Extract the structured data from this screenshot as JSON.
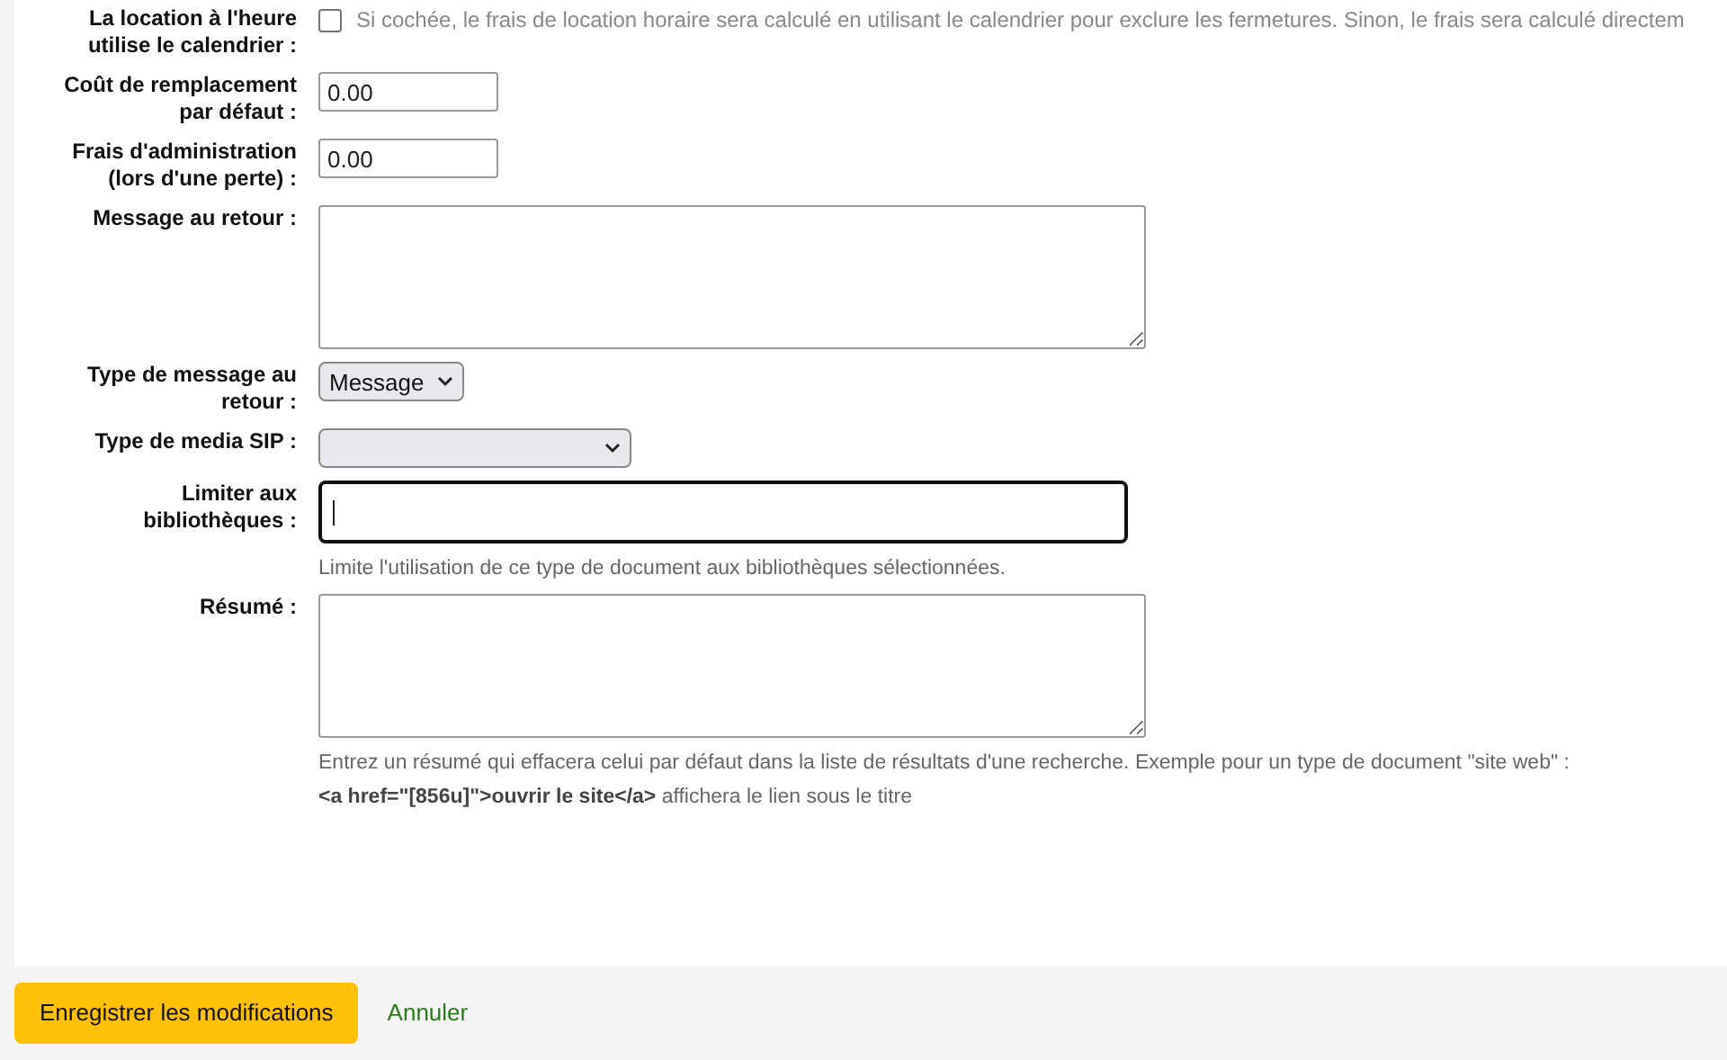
{
  "fields": [
    {
      "kind": "checkbox",
      "label": "La location à l'heure utilise le calendrier :",
      "checked": false,
      "text": "Si cochée, le frais de location horaire sera calculé en utilisant le calendrier pour exclure les fermetures. Sinon, le frais sera calculé directem"
    },
    {
      "kind": "text",
      "label": "Coût de remplacement par défaut :",
      "value": "0.00"
    },
    {
      "kind": "text",
      "label": "Frais d'administration (lors d'une perte) :",
      "value": "0.00"
    },
    {
      "kind": "textarea",
      "label": "Message au retour :"
    },
    {
      "kind": "select",
      "label": "Type de message au retour :",
      "value": "Message"
    },
    {
      "kind": "select",
      "label": "Type de media SIP :"
    },
    {
      "kind": "focused",
      "label": "Limiter aux bibliothèques :",
      "hints": [
        "Limite l'utilisation de ce type de document aux bibliothèques sélectionnées."
      ]
    },
    {
      "kind": "textarea",
      "label": "Résumé :",
      "hints": [
        "Entrez un résumé qui effacera celui par défaut dans la liste de résultats d'une recherche. Exemple pour un type de document \"site web\" :",
        "**<a href=\"[856u]\">ouvrir le site</a>** affichera le lien sous le titre"
      ]
    }
  ],
  "actions": {
    "save": "Enregistrer les modifications",
    "cancel": "Annuler"
  }
}
